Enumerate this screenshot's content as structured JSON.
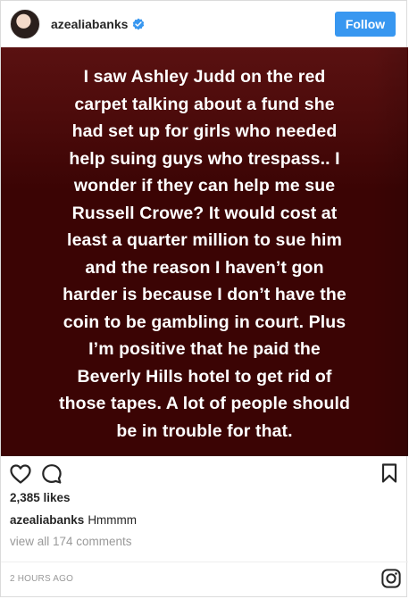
{
  "header": {
    "username": "azealiabanks",
    "follow_label": "Follow",
    "accent_color": "#3897f0"
  },
  "post": {
    "text": "I saw Ashley Judd on the red\ncarpet talking about a fund she\nhad set up for girls who needed\nhelp suing guys who trespass.. I\nwonder if they can help me sue\nRussell Crowe? It would cost at\nleast a quarter million to sue him\nand the reason I haven’t gon\nharder is because I don’t have the\ncoin to be gambling in court. Plus\nI’m positive that he paid the\nBeverly Hills hotel to get rid of\nthose tapes. A lot of people should\nbe in trouble for that.",
    "background_color": "#3f0707"
  },
  "actions": {
    "like_icon": "heart-icon",
    "comment_icon": "comment-icon",
    "save_icon": "bookmark-icon"
  },
  "likes": "2,385 likes",
  "caption": {
    "author": "azealiabanks",
    "text": "Hmmmm"
  },
  "comments_link": "view all 174 comments",
  "timestamp": "2 HOURS AGO",
  "footer_icon": "instagram-icon"
}
